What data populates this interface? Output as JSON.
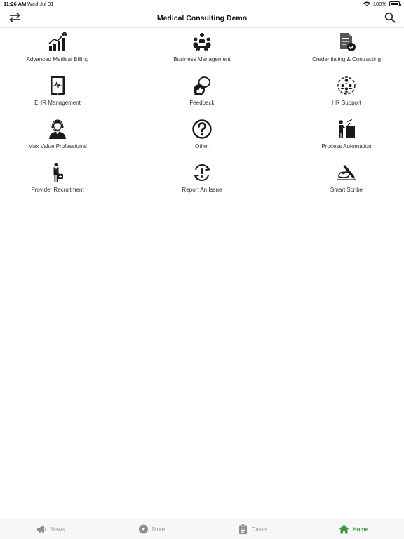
{
  "status": {
    "time": "11:26 AM",
    "date": "Wed Jul 31",
    "battery": "100%",
    "battery_level": 1.0
  },
  "header": {
    "title": "Medical Consulting Demo",
    "left_icon": "swap-arrows-icon",
    "right_icon": "search-icon"
  },
  "tiles": [
    {
      "label": "Advanced Medical Billing",
      "icon": "billing-growth-chart-icon"
    },
    {
      "label": "Business Management",
      "icon": "business-meeting-icon"
    },
    {
      "label": "Credentialing & Contracting",
      "icon": "document-check-icon"
    },
    {
      "label": "EHR Management",
      "icon": "tablet-heartbeat-icon"
    },
    {
      "label": "Feedback",
      "icon": "feedback-bubbles-icon"
    },
    {
      "label": "HR Support",
      "icon": "people-network-icon"
    },
    {
      "label": "Max Value Professional",
      "icon": "headset-professional-icon"
    },
    {
      "label": "Other",
      "icon": "question-circle-icon"
    },
    {
      "label": "Process Automation",
      "icon": "presenter-board-icon"
    },
    {
      "label": "Provider Recruitment",
      "icon": "doctor-bag-icon"
    },
    {
      "label": "Report An Issue",
      "icon": "alert-refresh-icon"
    },
    {
      "label": "Smart Scribe",
      "icon": "hand-writing-icon"
    }
  ],
  "tabs": [
    {
      "label": "News",
      "icon": "megaphone-icon",
      "active": false
    },
    {
      "label": "More",
      "icon": "chevron-circle-icon",
      "active": false
    },
    {
      "label": "Cases",
      "icon": "clipboard-icon",
      "active": false
    },
    {
      "label": "Home",
      "icon": "home-icon",
      "active": true
    }
  ],
  "colors": {
    "accent": "#3a9a42",
    "tab_inactive": "#8e8e8e",
    "icon": "#1a1a1a"
  }
}
